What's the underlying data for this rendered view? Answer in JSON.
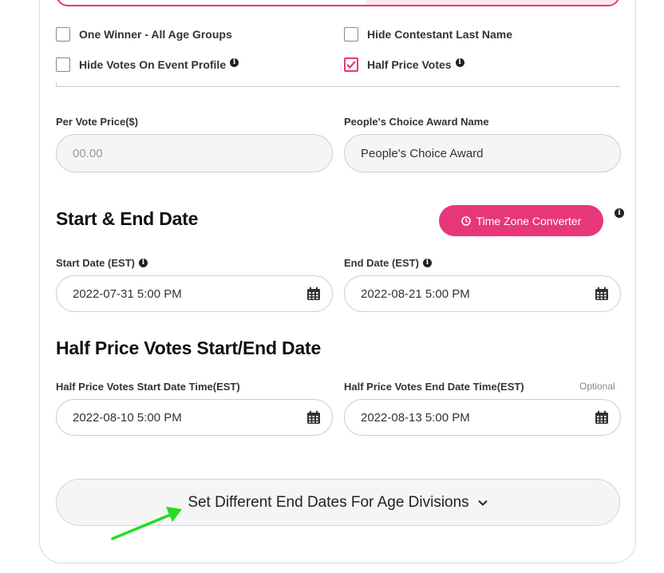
{
  "options": {
    "one_winner": {
      "label": "One Winner - All Age Groups",
      "checked": false
    },
    "hide_last_name": {
      "label": "Hide Contestant Last Name",
      "checked": false
    },
    "hide_votes": {
      "label": "Hide Votes On Event Profile",
      "checked": false
    },
    "half_price": {
      "label": "Half Price Votes",
      "checked": true
    }
  },
  "per_vote": {
    "label": "Per Vote Price($)",
    "placeholder": "00.00"
  },
  "award_name": {
    "label": "People's Choice Award Name",
    "value": "People's Choice Award"
  },
  "start_end": {
    "heading": "Start & End Date",
    "tz_button": "Time Zone Converter",
    "start_label": "Start Date (EST)",
    "start_value": "2022-07-31 5:00 PM",
    "end_label": "End Date (EST)",
    "end_value": "2022-08-21 5:00 PM"
  },
  "half_price_dates": {
    "heading": "Half Price Votes Start/End Date",
    "start_label": "Half Price Votes Start Date Time(EST)",
    "start_value": "2022-08-10 5:00 PM",
    "end_label": "Half Price Votes End Date Time(EST)",
    "end_value": "2022-08-13 5:00 PM",
    "optional": "Optional"
  },
  "age_divisions": {
    "label": "Set Different End Dates For Age Divisions"
  },
  "colors": {
    "accent": "#e8367a",
    "arrow": "#22dd22"
  },
  "icons": {
    "info": "info-icon",
    "calendar": "calendar-icon",
    "clock": "clock-icon",
    "chevron": "chevron-down-icon",
    "check": "check-icon"
  }
}
